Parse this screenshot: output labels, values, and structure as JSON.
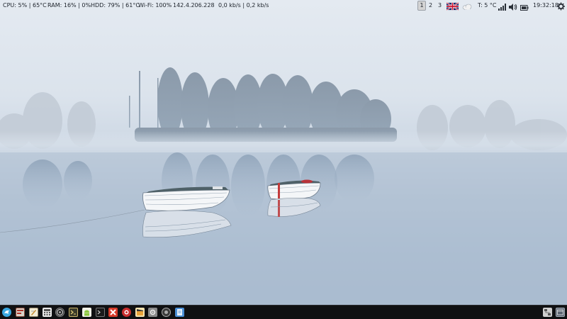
{
  "top_panel": {
    "cpu": "CPU: 5% | 65°C",
    "ram": "RAM: 16% | 0%",
    "hdd": "HDD: 79% | 61°C",
    "wifi": "Wi-Fi: 100%",
    "ip": "142.4.206.228",
    "net_speed": "0,0 kb/s | 0,2 kb/s",
    "workspaces": [
      "1",
      "2",
      "3"
    ],
    "active_workspace": "1",
    "temperature": "T: 5 °C",
    "clock": "19:32:18",
    "keyboard_layout_icon": "uk-flag-icon",
    "weather_icon": "cloud-icon",
    "tray_icons": [
      "signal-icon",
      "volume-icon",
      "battery-icon",
      "gear-icon"
    ]
  },
  "taskbar": {
    "apps": [
      "launcher-icon",
      "app-icon",
      "text-editor-icon",
      "calculator-icon",
      "disc-icon",
      "terminal-icon",
      "android-icon",
      "console-icon",
      "x-app-icon",
      "help-icon",
      "clapper-icon",
      "settings-icon",
      "camera-icon",
      "document-icon"
    ],
    "tray": [
      "network-icon",
      "window-icon"
    ]
  },
  "colors": {
    "taskbar_bg": "#0f1012",
    "sky": "#e4eaf1",
    "water": "#a9bcd1"
  }
}
